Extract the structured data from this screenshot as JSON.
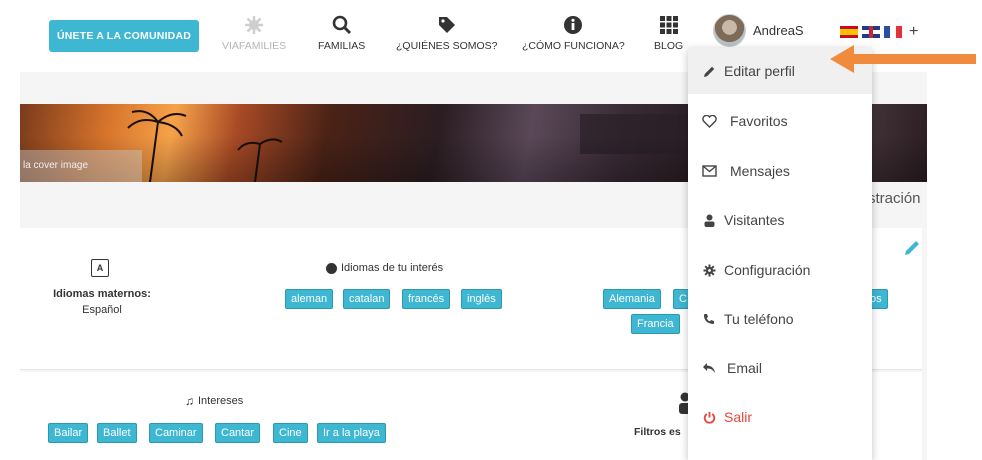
{
  "nav": {
    "join_label": "ÚNETE A LA COMUNIDAD",
    "items": [
      {
        "label": "VIAFAMILIES",
        "icon": "gear-icon"
      },
      {
        "label": "FAMILIAS",
        "icon": "search-icon"
      },
      {
        "label": "¿QUIÉNES SOMOS?",
        "icon": "tag-icon"
      },
      {
        "label": "¿CÓMO FUNCIONA?",
        "icon": "info-icon"
      },
      {
        "label": "BLOG",
        "icon": "grid-icon"
      }
    ],
    "username": "AndreaS",
    "languages": [
      "es",
      "en",
      "fr"
    ],
    "more_symbol": "+"
  },
  "cover": {
    "label": "la cover image"
  },
  "header_right_text": "stración",
  "profile": {
    "native_title": "Idiomas maternos:",
    "native_value": "Español",
    "interest_langs_title": "Idiomas de tu interés",
    "interest_langs": [
      "aleman",
      "catalan",
      "francés",
      "inglés"
    ],
    "countries_partial": [
      "Alemania",
      "C",
      "os",
      "Francia"
    ],
    "intereses_title": "Intereses",
    "intereses": [
      "Bailar",
      "Ballet",
      "Caminar",
      "Cantar",
      "Cine",
      "Ir a la playa"
    ],
    "filtros_label": "Filtros es"
  },
  "dropdown": {
    "items": [
      {
        "label": "Editar perfil",
        "icon": "pencil-icon"
      },
      {
        "label": "Favoritos",
        "icon": "heart-icon"
      },
      {
        "label": "Mensajes",
        "icon": "envelope-icon"
      },
      {
        "label": "Visitantes",
        "icon": "user-icon"
      },
      {
        "label": "Configuración",
        "icon": "gear-icon"
      },
      {
        "label": "Tu teléfono",
        "icon": "phone-icon"
      },
      {
        "label": "Email",
        "icon": "reply-icon"
      },
      {
        "label": "Salir",
        "icon": "power-icon"
      }
    ]
  },
  "colors": {
    "accent": "#3db7d2",
    "danger": "#e8453c",
    "annotation_arrow": "#f08a3c"
  }
}
